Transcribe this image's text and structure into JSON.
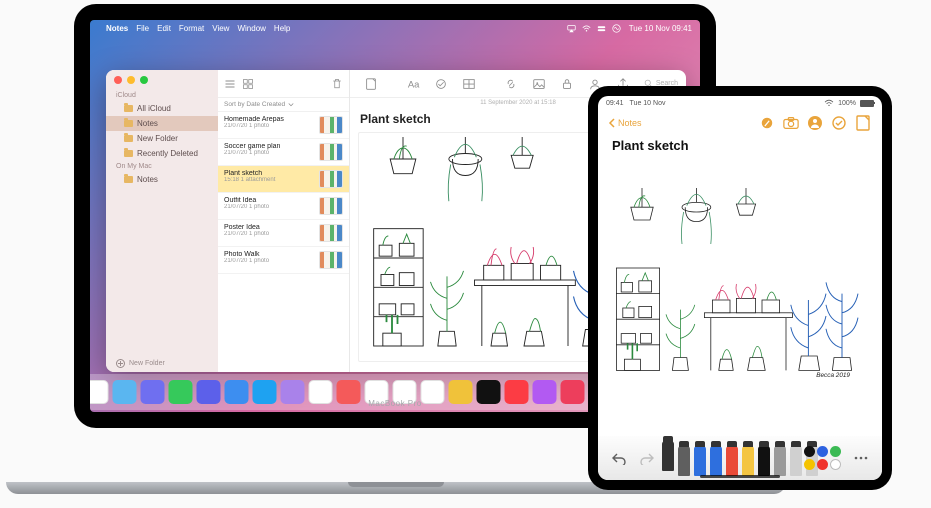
{
  "mac": {
    "label": "MacBook Pro",
    "menubar": {
      "apple": "",
      "items": [
        "Notes",
        "File",
        "Edit",
        "Format",
        "View",
        "Window",
        "Help"
      ],
      "clock": "Tue 10 Nov  09:41"
    },
    "window": {
      "sidebar": {
        "section1": "iCloud",
        "items1": [
          {
            "label": "All iCloud"
          },
          {
            "label": "Notes"
          },
          {
            "label": "New Folder"
          },
          {
            "label": "Recently Deleted"
          }
        ],
        "section2": "On My Mac",
        "items2": [
          {
            "label": "Notes"
          }
        ],
        "new_folder_label": "New Folder"
      },
      "list": {
        "sort_label": "Sort by Date Created",
        "notes": [
          {
            "title": "Homemade Arepas",
            "meta": "21/07/20   1 photo"
          },
          {
            "title": "Soccer game plan",
            "meta": "21/07/20   1 photo"
          },
          {
            "title": "Plant sketch",
            "meta": "15:18   1 attachment"
          },
          {
            "title": "Outfit Idea",
            "meta": "21/07/20   1 photo"
          },
          {
            "title": "Poster Idea",
            "meta": "21/07/20   1 photo"
          },
          {
            "title": "Photo Walk",
            "meta": "21/07/20   1 photo"
          }
        ],
        "selected_index": 2
      },
      "content": {
        "date_line": "11 September 2020 at 15:18",
        "title": "Plant sketch",
        "search_placeholder": "Search"
      }
    },
    "dock_colors": [
      "#fff",
      "#5ab6f0",
      "#6f6ff0",
      "#36c95b",
      "#5c60ea",
      "#3d8ef0",
      "#1ea2f1",
      "#a982ea",
      "#fff",
      "#f45a5a",
      "#fff",
      "#fff",
      "#fff",
      "#f0c23a",
      "#111",
      "#fc3c44",
      "#b25af2",
      "#ed3e5c",
      "#fff",
      "#4a9ef0",
      "#9099a2",
      "#6f7378"
    ]
  },
  "ipad": {
    "status": {
      "time": "09:41",
      "date": "Tue 10 Nov",
      "battery_label": "100%"
    },
    "toolbar": {
      "back_label": "Notes"
    },
    "note_title": "Plant sketch",
    "tools": {
      "colors": [
        "#111",
        "#2d62e0",
        "#3bba54",
        "#f5c300",
        "#f0332c",
        "#fff"
      ],
      "pens": [
        "#333333",
        "#5f5f5f",
        "#2e6fde",
        "#2e6fde",
        "#ea4b38",
        "#f4c542",
        "#111111",
        "#9a9a9a"
      ],
      "selected_pen_index": 0
    }
  },
  "sketch_signature": "Becca 2019"
}
